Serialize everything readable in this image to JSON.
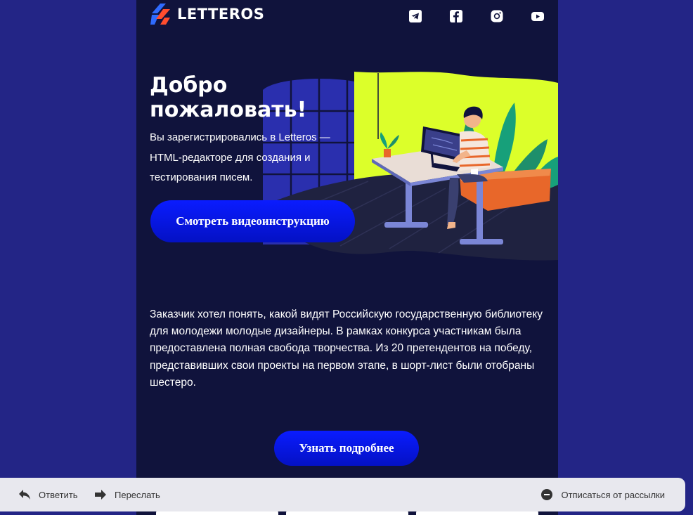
{
  "header": {
    "logo_text": "LETTEROS",
    "social_icons": [
      "telegram-icon",
      "facebook-icon",
      "instagram-icon",
      "youtube-icon"
    ]
  },
  "hero": {
    "title": "Добро пожаловать!",
    "text": "Вы зарегистрировались в Letteros — HTML-редакторе для создания и тестирования писем.",
    "button_label": "Смотреть видеоинструкцию"
  },
  "content": {
    "paragraph": "Заказчик хотел понять, какой видят Российскую государственную библиотеку для молодежи молодые дизайнеры. В рамках конкурса участникам была предоставлена полная свобода творчества. Из 20 претендентов на победу, представивших свои проекты на первом этапе, в шорт-лист были отобраны шестеро.",
    "button_label": "Узнать подробнее"
  },
  "action_bar": {
    "reply_label": "Ответить",
    "forward_label": "Переслать",
    "unsubscribe_label": "Отписаться от рассылки"
  },
  "colors": {
    "page_background": "#232586",
    "email_background": "#10133c",
    "button": "#0a1cff",
    "accent_lime": "#dcff2a",
    "accent_orange": "#ff4d2e"
  }
}
